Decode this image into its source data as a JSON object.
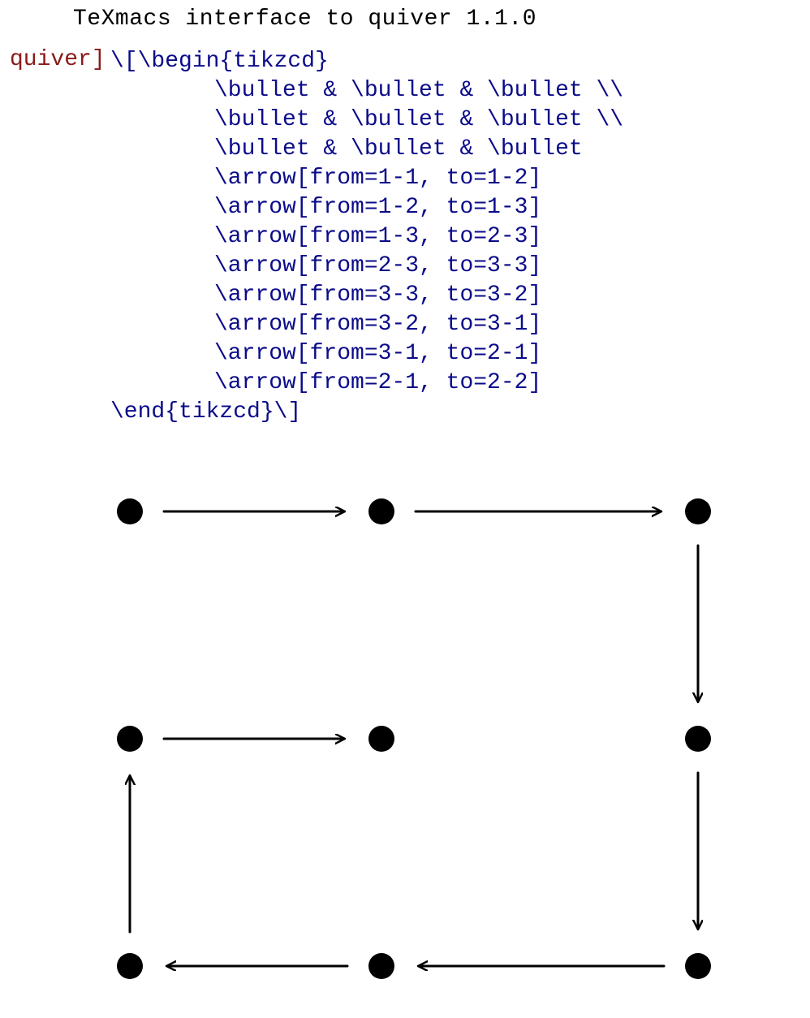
{
  "title": "TeXmacs interface to quiver 1.1.0",
  "prompt": {
    "label": "quiver]"
  },
  "code": {
    "open": "\\[\\begin{tikzcd}",
    "row1": "\\bullet & \\bullet & \\bullet \\\\",
    "row2": "\\bullet & \\bullet & \\bullet \\\\",
    "row3": "\\bullet & \\bullet & \\bullet",
    "a1": "\\arrow[from=1-1, to=1-2]",
    "a2": "\\arrow[from=1-2, to=1-3]",
    "a3": "\\arrow[from=1-3, to=2-3]",
    "a4": "\\arrow[from=2-3, to=3-3]",
    "a5": "\\arrow[from=3-3, to=3-2]",
    "a6": "\\arrow[from=3-2, to=3-1]",
    "a7": "\\arrow[from=3-1, to=2-1]",
    "a8": "\\arrow[from=2-1, to=2-2]",
    "close": "\\end{tikzcd}\\]"
  },
  "diagram": {
    "nodes": [
      {
        "id": "n11",
        "row": 1,
        "col": 1
      },
      {
        "id": "n12",
        "row": 1,
        "col": 2
      },
      {
        "id": "n13",
        "row": 1,
        "col": 3
      },
      {
        "id": "n21",
        "row": 2,
        "col": 1
      },
      {
        "id": "n22",
        "row": 2,
        "col": 2
      },
      {
        "id": "n23",
        "row": 2,
        "col": 3
      },
      {
        "id": "n31",
        "row": 3,
        "col": 1
      },
      {
        "id": "n32",
        "row": 3,
        "col": 2
      },
      {
        "id": "n33",
        "row": 3,
        "col": 3
      }
    ],
    "arrows": [
      {
        "from": "n11",
        "to": "n12"
      },
      {
        "from": "n12",
        "to": "n13"
      },
      {
        "from": "n13",
        "to": "n23"
      },
      {
        "from": "n23",
        "to": "n33"
      },
      {
        "from": "n33",
        "to": "n32"
      },
      {
        "from": "n32",
        "to": "n31"
      },
      {
        "from": "n31",
        "to": "n21"
      },
      {
        "from": "n21",
        "to": "n22"
      }
    ],
    "layout": {
      "col_x": {
        "1": 120,
        "2": 430,
        "3": 820
      },
      "row_y": {
        "1": 40,
        "2": 320,
        "3": 600
      },
      "node_r": 16,
      "gap": 26
    }
  }
}
